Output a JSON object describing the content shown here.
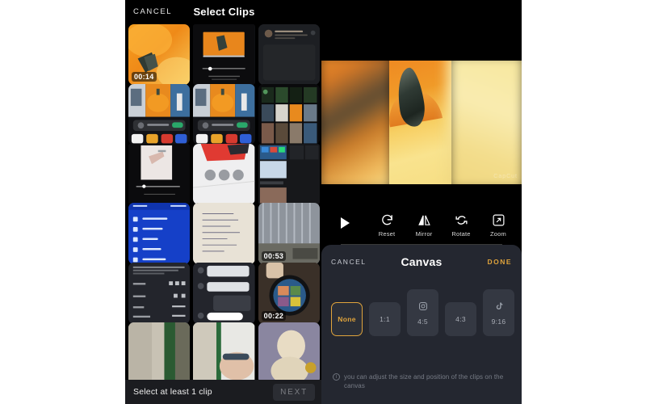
{
  "left_panel": {
    "cancel_label": "CANCEL",
    "title": "Select Clips",
    "footer_hint": "Select at least 1 clip",
    "next_label": "NEXT",
    "clips": [
      {
        "name": "pumpkin-closeup",
        "duration": "00:14"
      },
      {
        "name": "video-player-screenshot",
        "duration": ""
      },
      {
        "name": "social-post-dark",
        "duration": ""
      },
      {
        "name": "app-screenshot-pumpkin-a",
        "duration": ""
      },
      {
        "name": "app-screenshot-pumpkin-b",
        "duration": ""
      },
      {
        "name": "photo-gallery-grid",
        "duration": ""
      },
      {
        "name": "hand-nails-video",
        "duration": ""
      },
      {
        "name": "red-shoe-controls",
        "duration": ""
      },
      {
        "name": "games-apps-screen",
        "duration": ""
      },
      {
        "name": "blue-banking-menu",
        "duration": ""
      },
      {
        "name": "handwritten-notes",
        "duration": ""
      },
      {
        "name": "city-window-view",
        "duration": "00:53"
      },
      {
        "name": "dark-stats-screen",
        "duration": ""
      },
      {
        "name": "chat-conversation",
        "duration": ""
      },
      {
        "name": "smartwatch-photos",
        "duration": "00:22"
      },
      {
        "name": "interior-green-door",
        "duration": ""
      },
      {
        "name": "person-closeup",
        "duration": ""
      },
      {
        "name": "dog-on-blanket",
        "duration": ""
      }
    ]
  },
  "right_panel": {
    "preview": {
      "watermark": "CapCut"
    },
    "toolbar": {
      "play_label": "",
      "items": [
        {
          "icon": "reset-icon",
          "label": "Reset"
        },
        {
          "icon": "mirror-icon",
          "label": "Mirror"
        },
        {
          "icon": "rotate-icon",
          "label": "Rotate"
        },
        {
          "icon": "zoom-icon",
          "label": "Zoom"
        }
      ]
    },
    "canvas_sheet": {
      "cancel_label": "CANCEL",
      "title": "Canvas",
      "done_label": "DONE",
      "done_color": "#e0a43c",
      "selected_ratio": "None",
      "ratios": [
        {
          "label": "None",
          "icon": "",
          "selected": true
        },
        {
          "label": "1:1",
          "icon": "",
          "selected": false
        },
        {
          "label": "4:5",
          "icon": "instagram-icon",
          "selected": false
        },
        {
          "label": "4:3",
          "icon": "",
          "selected": false
        },
        {
          "label": "9:16",
          "icon": "tiktok-icon",
          "selected": false
        }
      ],
      "note_icon": "info-icon",
      "note_text": "you can adjust the size and position of the clips on the canvas"
    }
  }
}
